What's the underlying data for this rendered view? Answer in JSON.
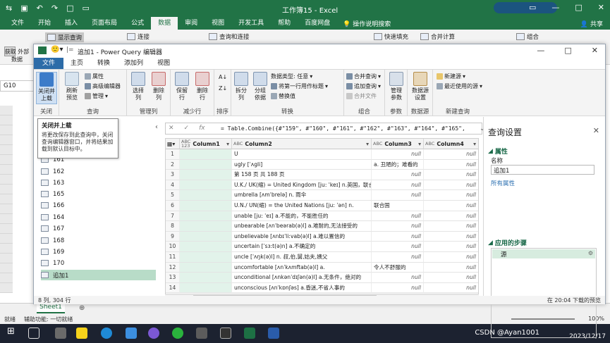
{
  "excel": {
    "window_title": "工作簿15 - Excel",
    "tabs": [
      "文件",
      "开始",
      "插入",
      "页面布局",
      "公式",
      "数据",
      "审阅",
      "视图",
      "开发工具",
      "帮助",
      "百度网盘"
    ],
    "active_tab": "数据",
    "tell_me": "操作说明搜索",
    "share": "共享",
    "ribbon": {
      "get_data": "获取\n外部数据",
      "show_queries": "显示查询",
      "connections": "连接",
      "queries_connections": "查询和连接",
      "flash_fill": "快速填充",
      "consolidate": "合并计算",
      "group": "组合"
    },
    "name_box": "G10",
    "sheet_tab": "Sheet1",
    "status": {
      "ready": "就绪",
      "accessibility": "辅助功能: 一切就绪",
      "zoom": "100%"
    }
  },
  "pq": {
    "title": "追加1 - Power Query 编辑器",
    "tabs": [
      "文件",
      "主页",
      "转换",
      "添加列",
      "视图"
    ],
    "ribbon": {
      "close_load": "关闭并\n上载",
      "close_group": "关闭",
      "refresh": "刷新\n预览",
      "properties": "属性",
      "advanced_editor": "高级编辑器",
      "manage": "管理",
      "query_group": "查询",
      "choose_cols": "选择\n列",
      "remove_cols": "删除\n列",
      "manage_cols_group": "管理列",
      "keep_rows": "保留\n行",
      "remove_rows": "删除\n行",
      "reduce_rows_group": "减少行",
      "sort_group": "排序",
      "split_col": "拆分\n列",
      "group_by": "分组\n依据",
      "data_type": "数据类型: 任意",
      "first_row_header": "将第一行用作标题",
      "replace_values": "替换值",
      "transform_group": "转换",
      "merge_queries": "合并查询",
      "append_queries": "追加查询",
      "combine_files": "合并文件",
      "combine_group": "组合",
      "manage_params": "管理\n参数",
      "params_group": "参数",
      "data_source_settings": "数据源\n设置",
      "datasource_group": "数据源",
      "new_source": "新建源",
      "recent_sources": "最近使用的源",
      "new_query_group": "新建查询"
    },
    "tooltip": {
      "title": "关闭并上载",
      "body": "将更改保存到此查询中，关闭查询编辑器窗口，并将结果加载到默认目标中。"
    },
    "queries": [
      "161",
      "162",
      "163",
      "165",
      "166",
      "164",
      "167",
      "168",
      "169",
      "170",
      "追加1"
    ],
    "selected_query": "追加1",
    "formula": "= Table.Combine({#\"159\", #\"160\", #\"161\", #\"162\", #\"163\", #\"164\", #\"165\",",
    "columns": [
      {
        "type": "ABC\n123",
        "name": "Column1"
      },
      {
        "type": "ABC",
        "name": "Column2"
      },
      {
        "type": "ABC",
        "name": "Column3"
      },
      {
        "type": "ABC",
        "name": "Column4"
      }
    ],
    "rows": [
      [
        "",
        "U",
        "null",
        "null"
      ],
      [
        "",
        "ugly [ˈʌgli]",
        "a. 丑陋的；难看的",
        "null"
      ],
      [
        "",
        "第 158 页 共 188 页",
        "null",
        "null"
      ],
      [
        "",
        "U.K./ UK(缩) = United Kingdom [ju: ˈkeɪ] n.英国，联合王...",
        "null",
        "null"
      ],
      [
        "",
        "umbrella [ʌmˈbrelə] n. 雨伞",
        "null",
        "null"
      ],
      [
        "",
        "U.N./ UN(缩) = the United Nations [ju: ˈən] n.",
        "联合国",
        "null"
      ],
      [
        "",
        "unable [ju: ˈeɪ] a.不能的，不能胜任的",
        "null",
        "null"
      ],
      [
        "",
        "unbearable [ʌnˈbeərab(ə)l] a.难耐的,无法接受的",
        "null",
        "null"
      ],
      [
        "",
        "unbelievable [ʌnbɪˈli:vab(ə)l] a.难以置信的",
        "null",
        "null"
      ],
      [
        "",
        "uncertain [ˈsɜ:t(ə)n] a.不确定的",
        "null",
        "null"
      ],
      [
        "",
        "uncle [ˈʌŋk(ə)l] n. 叔,伯,舅,姑夫,姨父",
        "null",
        "null"
      ],
      [
        "",
        "uncomfortable [ʌnˈkʌmftab(ə)l] a.",
        "令人不舒服的",
        "null"
      ],
      [
        "",
        "unconditional [ʌnkənˈdɪʃən(ə)l] a.无条件，绝对的",
        "null",
        "null"
      ],
      [
        "",
        "unconscious [ʌnˈkɒnʃəs] a.昏迷,不省人事的",
        "null",
        "null"
      ]
    ],
    "status_left": "8 列, 304 行",
    "status_right": "在 20:04 下载的预览",
    "settings": {
      "title": "查询设置",
      "properties": "属性",
      "name_label": "名称",
      "name_value": "追加1",
      "all_properties": "所有属性",
      "applied_steps": "应用的步骤",
      "step": "源"
    }
  },
  "taskbar": {
    "watermark": "CSDN @Ayan1001",
    "time": "2023/12/17"
  },
  "colors": {
    "excel_green": "#217346",
    "pq_blue": "#2d6ca8",
    "selected": "#b8dcc8",
    "column1_fill": "#e2f3ea"
  }
}
